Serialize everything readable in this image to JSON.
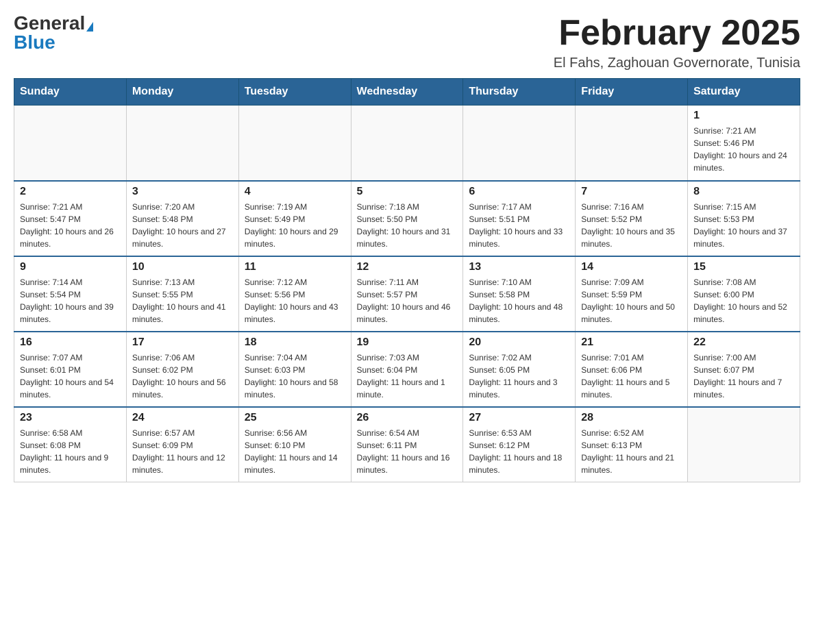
{
  "header": {
    "logo_general": "General",
    "logo_blue": "Blue",
    "month_title": "February 2025",
    "location": "El Fahs, Zaghouan Governorate, Tunisia"
  },
  "weekdays": [
    "Sunday",
    "Monday",
    "Tuesday",
    "Wednesday",
    "Thursday",
    "Friday",
    "Saturday"
  ],
  "weeks": [
    {
      "days": [
        {
          "num": "",
          "info": ""
        },
        {
          "num": "",
          "info": ""
        },
        {
          "num": "",
          "info": ""
        },
        {
          "num": "",
          "info": ""
        },
        {
          "num": "",
          "info": ""
        },
        {
          "num": "",
          "info": ""
        },
        {
          "num": "1",
          "info": "Sunrise: 7:21 AM\nSunset: 5:46 PM\nDaylight: 10 hours and 24 minutes."
        }
      ]
    },
    {
      "days": [
        {
          "num": "2",
          "info": "Sunrise: 7:21 AM\nSunset: 5:47 PM\nDaylight: 10 hours and 26 minutes."
        },
        {
          "num": "3",
          "info": "Sunrise: 7:20 AM\nSunset: 5:48 PM\nDaylight: 10 hours and 27 minutes."
        },
        {
          "num": "4",
          "info": "Sunrise: 7:19 AM\nSunset: 5:49 PM\nDaylight: 10 hours and 29 minutes."
        },
        {
          "num": "5",
          "info": "Sunrise: 7:18 AM\nSunset: 5:50 PM\nDaylight: 10 hours and 31 minutes."
        },
        {
          "num": "6",
          "info": "Sunrise: 7:17 AM\nSunset: 5:51 PM\nDaylight: 10 hours and 33 minutes."
        },
        {
          "num": "7",
          "info": "Sunrise: 7:16 AM\nSunset: 5:52 PM\nDaylight: 10 hours and 35 minutes."
        },
        {
          "num": "8",
          "info": "Sunrise: 7:15 AM\nSunset: 5:53 PM\nDaylight: 10 hours and 37 minutes."
        }
      ]
    },
    {
      "days": [
        {
          "num": "9",
          "info": "Sunrise: 7:14 AM\nSunset: 5:54 PM\nDaylight: 10 hours and 39 minutes."
        },
        {
          "num": "10",
          "info": "Sunrise: 7:13 AM\nSunset: 5:55 PM\nDaylight: 10 hours and 41 minutes."
        },
        {
          "num": "11",
          "info": "Sunrise: 7:12 AM\nSunset: 5:56 PM\nDaylight: 10 hours and 43 minutes."
        },
        {
          "num": "12",
          "info": "Sunrise: 7:11 AM\nSunset: 5:57 PM\nDaylight: 10 hours and 46 minutes."
        },
        {
          "num": "13",
          "info": "Sunrise: 7:10 AM\nSunset: 5:58 PM\nDaylight: 10 hours and 48 minutes."
        },
        {
          "num": "14",
          "info": "Sunrise: 7:09 AM\nSunset: 5:59 PM\nDaylight: 10 hours and 50 minutes."
        },
        {
          "num": "15",
          "info": "Sunrise: 7:08 AM\nSunset: 6:00 PM\nDaylight: 10 hours and 52 minutes."
        }
      ]
    },
    {
      "days": [
        {
          "num": "16",
          "info": "Sunrise: 7:07 AM\nSunset: 6:01 PM\nDaylight: 10 hours and 54 minutes."
        },
        {
          "num": "17",
          "info": "Sunrise: 7:06 AM\nSunset: 6:02 PM\nDaylight: 10 hours and 56 minutes."
        },
        {
          "num": "18",
          "info": "Sunrise: 7:04 AM\nSunset: 6:03 PM\nDaylight: 10 hours and 58 minutes."
        },
        {
          "num": "19",
          "info": "Sunrise: 7:03 AM\nSunset: 6:04 PM\nDaylight: 11 hours and 1 minute."
        },
        {
          "num": "20",
          "info": "Sunrise: 7:02 AM\nSunset: 6:05 PM\nDaylight: 11 hours and 3 minutes."
        },
        {
          "num": "21",
          "info": "Sunrise: 7:01 AM\nSunset: 6:06 PM\nDaylight: 11 hours and 5 minutes."
        },
        {
          "num": "22",
          "info": "Sunrise: 7:00 AM\nSunset: 6:07 PM\nDaylight: 11 hours and 7 minutes."
        }
      ]
    },
    {
      "days": [
        {
          "num": "23",
          "info": "Sunrise: 6:58 AM\nSunset: 6:08 PM\nDaylight: 11 hours and 9 minutes."
        },
        {
          "num": "24",
          "info": "Sunrise: 6:57 AM\nSunset: 6:09 PM\nDaylight: 11 hours and 12 minutes."
        },
        {
          "num": "25",
          "info": "Sunrise: 6:56 AM\nSunset: 6:10 PM\nDaylight: 11 hours and 14 minutes."
        },
        {
          "num": "26",
          "info": "Sunrise: 6:54 AM\nSunset: 6:11 PM\nDaylight: 11 hours and 16 minutes."
        },
        {
          "num": "27",
          "info": "Sunrise: 6:53 AM\nSunset: 6:12 PM\nDaylight: 11 hours and 18 minutes."
        },
        {
          "num": "28",
          "info": "Sunrise: 6:52 AM\nSunset: 6:13 PM\nDaylight: 11 hours and 21 minutes."
        },
        {
          "num": "",
          "info": ""
        }
      ]
    }
  ]
}
